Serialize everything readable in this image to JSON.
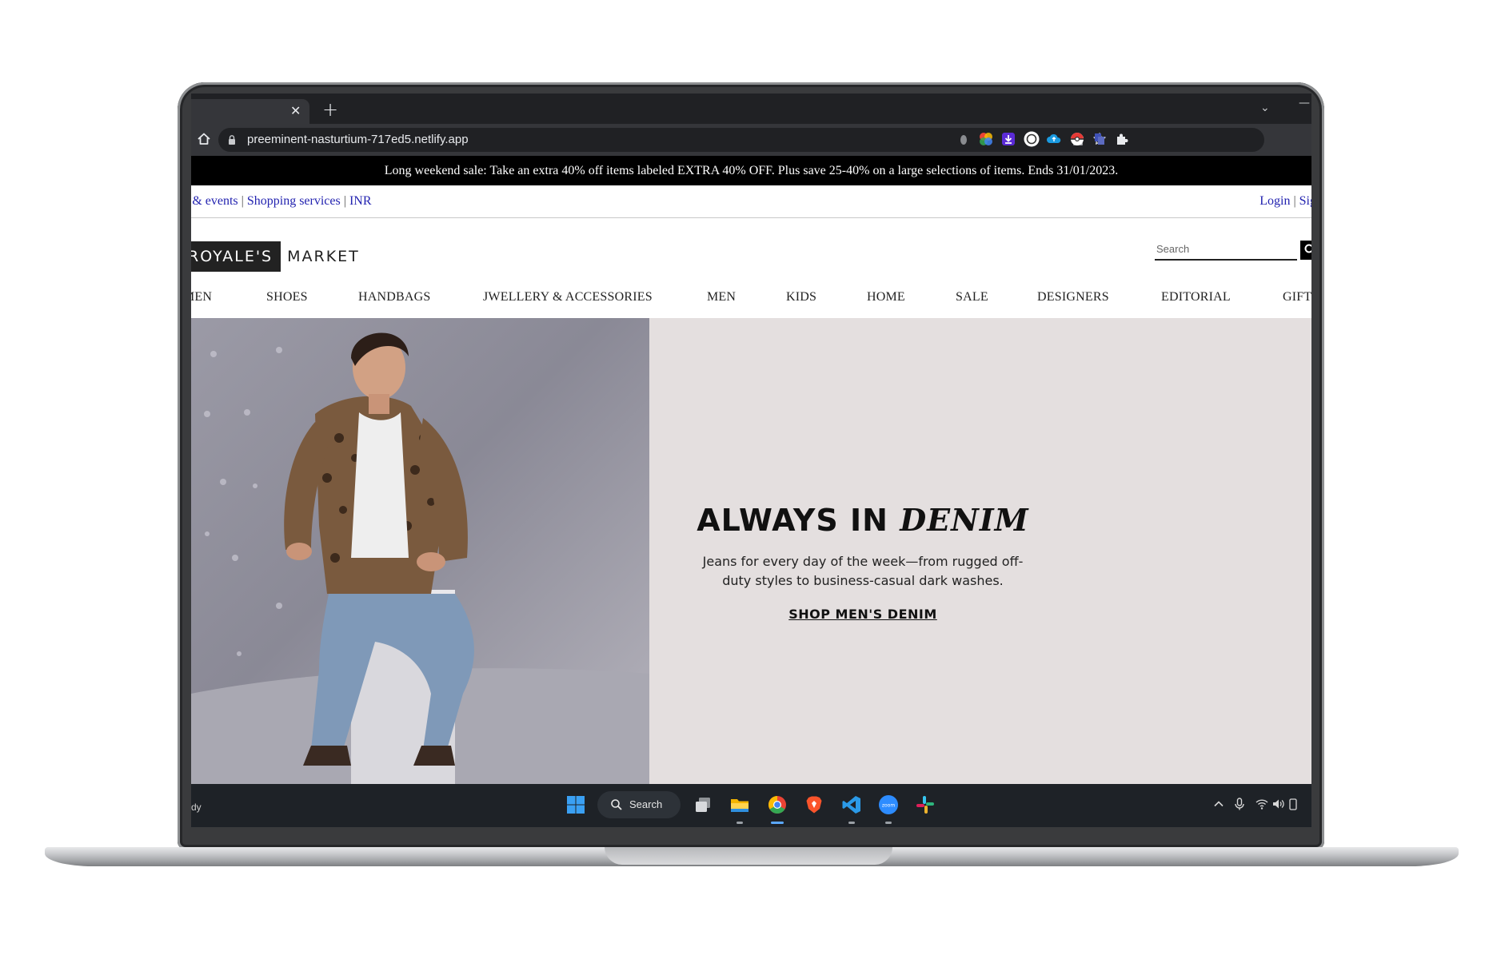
{
  "browser": {
    "url": "preeminent-nasturtium-717ed5.netlify.app"
  },
  "promo": {
    "text": "Long weekend sale: Take an extra 40% off items labeled EXTRA 40% OFF. Plus save 25-40% on a large selections of items. Ends 31/01/2023."
  },
  "utility": {
    "left_links": [
      "es & events",
      "Shopping services",
      "INR"
    ],
    "right_links": [
      "Login",
      "Sign"
    ]
  },
  "logo": {
    "boxed": "ROYALE'S",
    "text": "MARKET"
  },
  "search": {
    "placeholder": "Search"
  },
  "nav": {
    "items": [
      "MEN",
      "SHOES",
      "HANDBAGS",
      "JWELLERY & ACCESSORIES",
      "MEN",
      "KIDS",
      "HOME",
      "SALE",
      "DESIGNERS",
      "EDITORIAL",
      "GIFT"
    ]
  },
  "hero": {
    "heading_plain": "ALWAYS IN",
    "heading_italic": "DENIM",
    "subtext": "Jeans for every day of the week—from rugged off-duty styles to business-casual dark washes.",
    "cta": "SHOP MEN'S DENIM"
  },
  "taskbar": {
    "status_fragment": "dy",
    "search_label": "Search"
  },
  "colors": {
    "promo_bg": "#000000",
    "link": "#2323b0",
    "hero_bg": "#e4dfdf",
    "taskbar_bg": "#1e2227",
    "browser_dark": "#202124"
  }
}
